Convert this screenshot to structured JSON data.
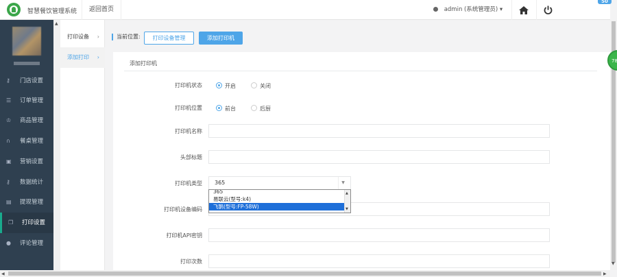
{
  "header": {
    "app_title": "智慧餐饮管理系统",
    "back_home": "返回首页",
    "user": "admin (系统管理员)",
    "user_caret": "▾",
    "home_icon": "home-icon",
    "power_icon": "power-icon",
    "corner_badge": "50"
  },
  "sidebar": {
    "items": [
      {
        "label": "门店设置",
        "icon": "key-icon"
      },
      {
        "label": "订单管理",
        "icon": "list-icon"
      },
      {
        "label": "商品管理",
        "icon": "trophy-icon"
      },
      {
        "label": "餐桌管理",
        "icon": "binoculars-icon"
      },
      {
        "label": "营销设置",
        "icon": "gift-icon"
      },
      {
        "label": "数据统计",
        "icon": "key-icon"
      },
      {
        "label": "提现管理",
        "icon": "wallet-icon"
      },
      {
        "label": "打印设置",
        "icon": "copy-icon",
        "active": true
      },
      {
        "label": "评论管理",
        "icon": "user-icon"
      }
    ]
  },
  "subnav": {
    "items": [
      {
        "label": "打印设备",
        "chevron": "›"
      },
      {
        "label": "添加打印",
        "chevron": "›",
        "active": true
      }
    ]
  },
  "toolbar": {
    "current_position": "当前位置:",
    "manage_button": "打印设备管理",
    "add_button": "添加打印机"
  },
  "form": {
    "title": "添加打印机",
    "status_label": "打印机状态",
    "status_options": [
      "开启",
      "关闭"
    ],
    "status_selected": "开启",
    "position_label": "打印机位置",
    "position_options": [
      "前台",
      "后厨"
    ],
    "position_selected": "前台",
    "name_label": "打印机名称",
    "name_value": "",
    "header_label": "头部标题",
    "header_value": "",
    "type_label": "打印机类型",
    "type_value": "365",
    "type_options": [
      "365",
      "易联云(型号:k4)",
      "飞鹅(型号:FP-58W)"
    ],
    "type_highlighted": "飞鹅(型号:FP-58W)",
    "device_code_label": "打印机设备编码",
    "device_code_value": "",
    "api_key_label": "打印机API密钥",
    "api_key_value": "",
    "print_count_label": "打印次数",
    "print_count_value": ""
  },
  "floating_badge": "78",
  "colors": {
    "sidebar_bg": "#2f4050",
    "accent_blue": "#4ea5e8",
    "active_marker": "#19aa8d",
    "logo_green": "#3ba64a",
    "dropdown_highlight": "#1e6fd9"
  }
}
